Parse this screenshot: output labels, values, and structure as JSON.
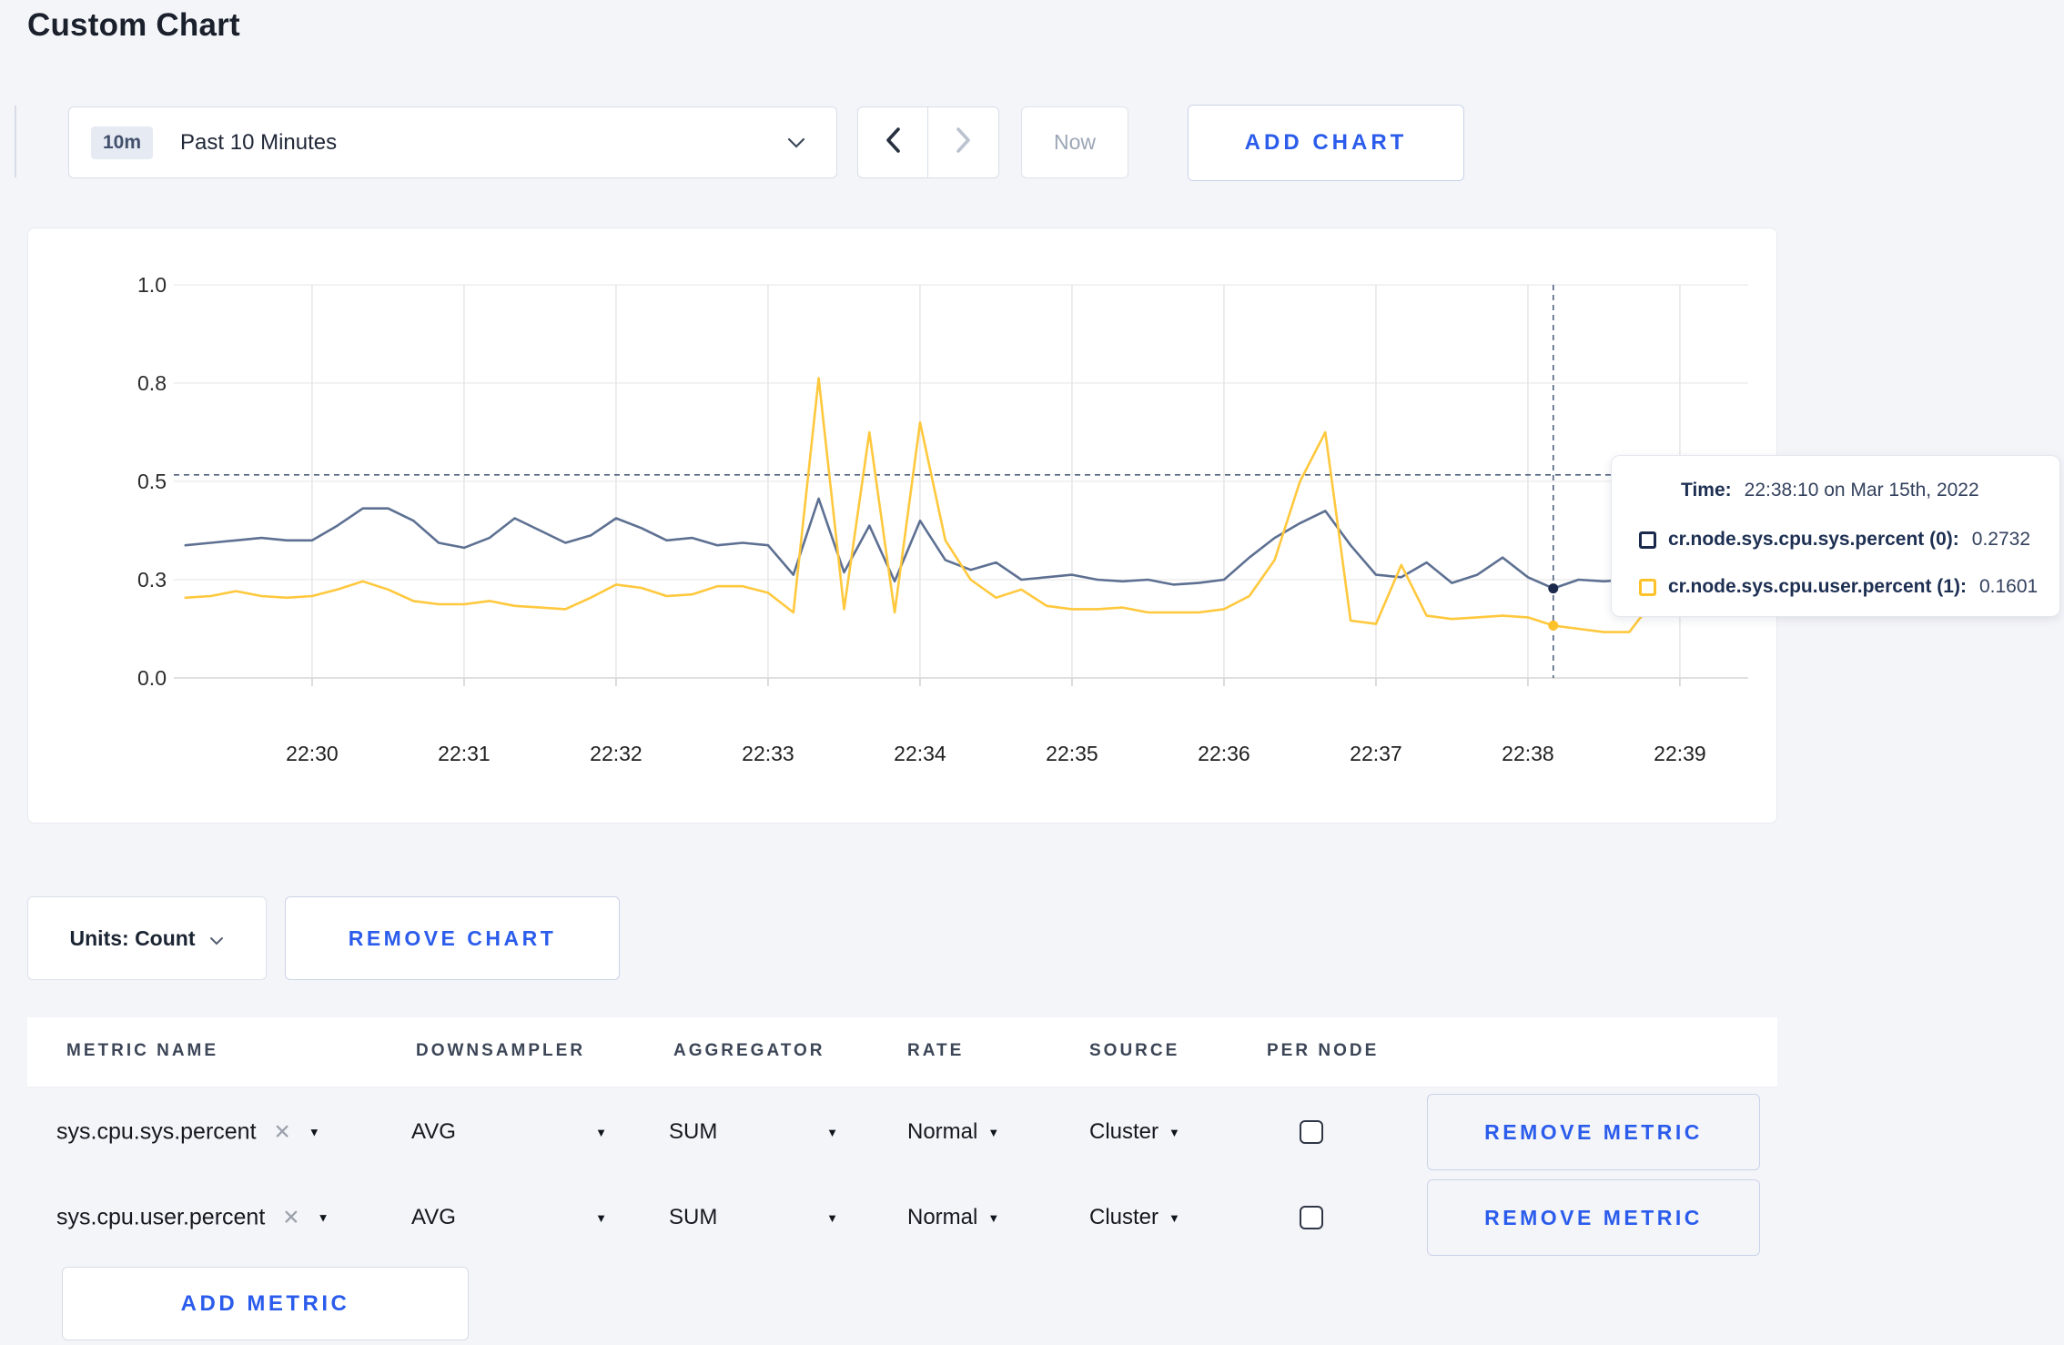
{
  "page": {
    "title": "Custom Chart"
  },
  "toolbar": {
    "time_selector": {
      "badge": "10m",
      "value": "Past 10 Minutes"
    },
    "prev_icon": "chevron-left",
    "next_icon": "chevron-right",
    "now_button": "Now",
    "add_chart_button": "ADD CHART"
  },
  "chart_card": {
    "chart_data": {
      "type": "line",
      "title": "",
      "xlabel": "",
      "ylabel": "",
      "x_axis": {
        "start_time": "22:29:10",
        "interval_seconds": 10,
        "tick_labels": [
          "22:30",
          "22:31",
          "22:32",
          "22:33",
          "22:34",
          "22:35",
          "22:36",
          "22:37",
          "22:38",
          "22:39"
        ]
      },
      "y_axis": {
        "tick_labels": [
          "0.0",
          "0.3",
          "0.5",
          "0.8",
          "1.0"
        ],
        "tick_values": [
          0,
          0.3,
          0.5,
          0.8,
          1.0
        ],
        "evenly_spaced_ticks": true,
        "grid": true
      },
      "series": [
        {
          "name": "cr.node.sys.cpu.sys.percent (0)",
          "color": "#5d7092",
          "legend_color": "#1b2a4c",
          "values": [
            0.37,
            0.375,
            0.38,
            0.385,
            0.38,
            0.38,
            0.41,
            0.445,
            0.445,
            0.42,
            0.375,
            0.365,
            0.385,
            0.425,
            0.4,
            0.375,
            0.39,
            0.425,
            0.405,
            0.38,
            0.385,
            0.37,
            0.375,
            0.37,
            0.31,
            0.465,
            0.315,
            0.41,
            0.295,
            0.42,
            0.34,
            0.32,
            0.335,
            0.3,
            0.305,
            0.31,
            0.3,
            0.295,
            0.3,
            0.285,
            0.29,
            0.3,
            0.345,
            0.385,
            0.415,
            0.44,
            0.37,
            0.31,
            0.305,
            0.335,
            0.29,
            0.31,
            0.345,
            0.305,
            0.2732,
            0.3,
            0.295,
            0.3,
            0.305,
            0.3,
            0.3,
            0.295
          ]
        },
        {
          "name": "cr.node.sys.cpu.user.percent (1)",
          "color": "#ffc83d",
          "legend_color": "#fdc12a",
          "values": [
            0.245,
            0.25,
            0.265,
            0.25,
            0.245,
            0.25,
            0.27,
            0.295,
            0.27,
            0.235,
            0.225,
            0.225,
            0.235,
            0.22,
            0.215,
            0.21,
            0.245,
            0.285,
            0.275,
            0.25,
            0.255,
            0.28,
            0.28,
            0.26,
            0.2,
            0.81,
            0.21,
            0.65,
            0.2,
            0.68,
            0.38,
            0.3,
            0.245,
            0.27,
            0.22,
            0.21,
            0.21,
            0.215,
            0.2,
            0.2,
            0.2,
            0.21,
            0.25,
            0.34,
            0.5,
            0.65,
            0.175,
            0.165,
            0.33,
            0.19,
            0.18,
            0.185,
            0.19,
            0.185,
            0.1601,
            0.15,
            0.14,
            0.14,
            0.24,
            0.285,
            0.22,
            0.27
          ]
        }
      ],
      "crosshair": {
        "time": "22:38:10",
        "index": 54,
        "hline_value": 0.52
      },
      "legend_position": "tooltip"
    },
    "tooltip": {
      "time_label": "Time:",
      "time_value": "22:38:10 on Mar 15th, 2022",
      "rows": [
        {
          "label": "cr.node.sys.cpu.sys.percent (0):",
          "value": "0.2732"
        },
        {
          "label": "cr.node.sys.cpu.user.percent (1):",
          "value": "0.1601"
        }
      ]
    }
  },
  "units_bar": {
    "units_button": "Units: Count",
    "remove_chart_button": "REMOVE CHART"
  },
  "metrics_table": {
    "columns": [
      "METRIC NAME",
      "DOWNSAMPLER",
      "AGGREGATOR",
      "RATE",
      "SOURCE",
      "PER NODE"
    ],
    "rows": [
      {
        "metric_name": "sys.cpu.sys.percent",
        "remove_icon": "✕",
        "downsampler": "AVG",
        "aggregator": "SUM",
        "rate": "Normal",
        "source": "Cluster",
        "per_node_checked": false,
        "remove_button": "REMOVE METRIC"
      },
      {
        "metric_name": "sys.cpu.user.percent",
        "remove_icon": "✕",
        "downsampler": "AVG",
        "aggregator": "SUM",
        "rate": "Normal",
        "source": "Cluster",
        "per_node_checked": false,
        "remove_button": "REMOVE METRIC"
      }
    ],
    "add_metric_button": "ADD METRIC"
  },
  "colors": {
    "accent_blue": "#2b5cec",
    "crosshair": "#50617d",
    "grid_h": "#ebebeb",
    "grid_v": "#e2e2e2",
    "axis_spine": "#d8d8d8",
    "axis_text": "#2b2b2b"
  }
}
